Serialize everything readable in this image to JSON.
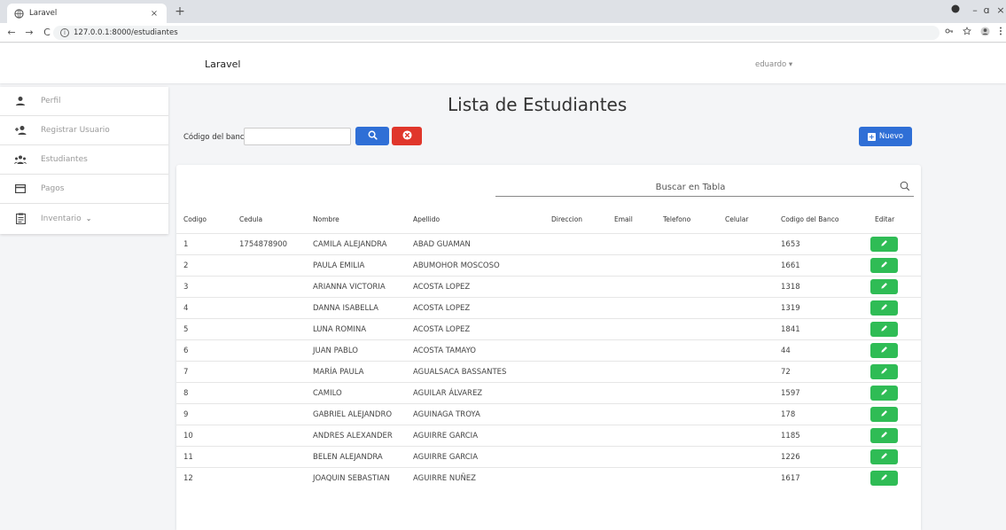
{
  "browser": {
    "tab_title": "Laravel",
    "tab_close": "×",
    "new_tab": "+",
    "url": "127.0.0.1:8000/estudiantes",
    "back": "←",
    "forward": "→",
    "reload": "C",
    "minimize": "–",
    "maximize": "ɑ",
    "close": "×"
  },
  "navbar": {
    "brand": "Laravel",
    "user": "eduardo ▾"
  },
  "sidebar": {
    "items": [
      {
        "label": "Perfil",
        "icon": "user-icon"
      },
      {
        "label": "Registrar Usuario",
        "icon": "user-add-icon"
      },
      {
        "label": "Estudiantes",
        "icon": "group-icon"
      },
      {
        "label": "Pagos",
        "icon": "card-icon"
      },
      {
        "label": "Inventario",
        "icon": "clipboard-icon",
        "chevron": "⌄"
      }
    ]
  },
  "main": {
    "title": "Lista de Estudiantes",
    "search_label": "Código del banco",
    "search_value": "",
    "new_label": "Nuevo",
    "table_search_placeholder": "Buscar en Tabla",
    "colors": {
      "primary": "#2f6fd6",
      "danger": "#e0362b",
      "success": "#2fbc55"
    }
  },
  "table": {
    "headers": [
      "Codigo",
      "Cedula",
      "Nombre",
      "Apellido",
      "Direccion",
      "Email",
      "Telefono",
      "Celular",
      "Codigo del Banco",
      "Editar"
    ],
    "rows": [
      {
        "codigo": "1",
        "cedula": "1754878900",
        "nombre": "CAMILA ALEJANDRA",
        "apellido": "ABAD GUAMAN",
        "banco": "1653"
      },
      {
        "codigo": "2",
        "cedula": "",
        "nombre": "PAULA EMILIA",
        "apellido": "ABUMOHOR MOSCOSO",
        "banco": "1661"
      },
      {
        "codigo": "3",
        "cedula": "",
        "nombre": "ARIANNA VICTORIA",
        "apellido": "ACOSTA LOPEZ",
        "banco": "1318"
      },
      {
        "codigo": "4",
        "cedula": "",
        "nombre": "DANNA ISABELLA",
        "apellido": "ACOSTA LOPEZ",
        "banco": "1319"
      },
      {
        "codigo": "5",
        "cedula": "",
        "nombre": "LUNA ROMINA",
        "apellido": "ACOSTA LOPEZ",
        "banco": "1841"
      },
      {
        "codigo": "6",
        "cedula": "",
        "nombre": "JUAN PABLO",
        "apellido": "ACOSTA TAMAYO",
        "banco": "44"
      },
      {
        "codigo": "7",
        "cedula": "",
        "nombre": "MARÍA PAULA",
        "apellido": "AGUALSACA BASSANTES",
        "banco": "72"
      },
      {
        "codigo": "8",
        "cedula": "",
        "nombre": "CAMILO",
        "apellido": "AGUILAR ÁLVAREZ",
        "banco": "1597"
      },
      {
        "codigo": "9",
        "cedula": "",
        "nombre": "GABRIEL ALEJANDRO",
        "apellido": "AGUINAGA TROYA",
        "banco": "178"
      },
      {
        "codigo": "10",
        "cedula": "",
        "nombre": "ANDRES ALEXANDER",
        "apellido": "AGUIRRE GARCIA",
        "banco": "1185"
      },
      {
        "codigo": "11",
        "cedula": "",
        "nombre": "BELEN ALEJANDRA",
        "apellido": "AGUIRRE GARCIA",
        "banco": "1226"
      },
      {
        "codigo": "12",
        "cedula": "",
        "nombre": "JOAQUIN SEBASTIAN",
        "apellido": "AGUIRRE NUÑEZ",
        "banco": "1617"
      }
    ]
  }
}
